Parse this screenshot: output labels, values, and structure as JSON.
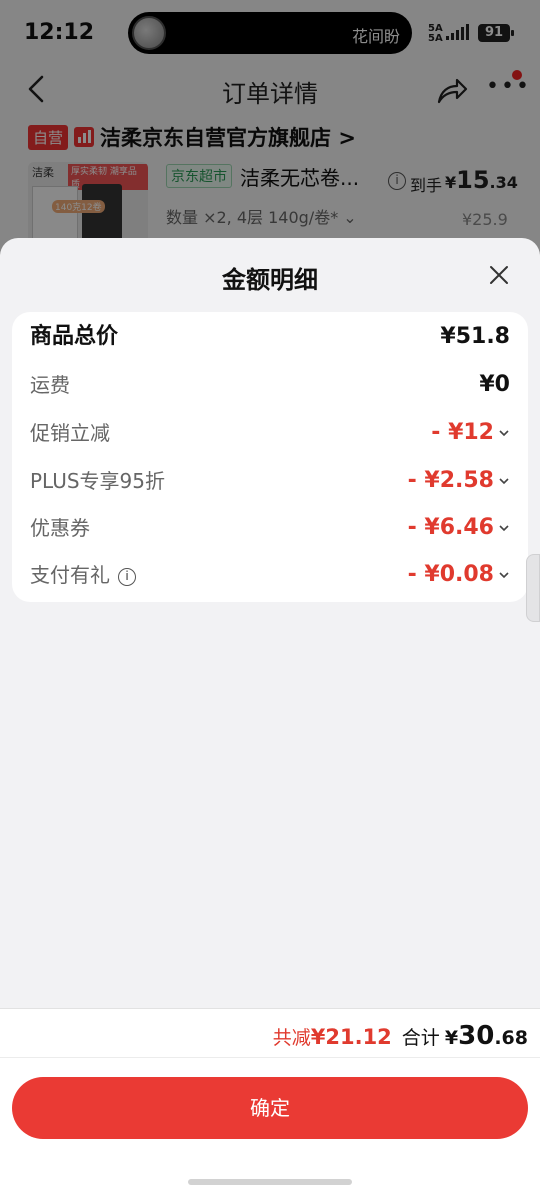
{
  "status_bar": {
    "time": "12:12",
    "island_text": "花间盼",
    "signal_top": "5A",
    "signal_bottom": "5A",
    "battery": "91"
  },
  "nav": {
    "title": "订单详情",
    "back_icon": "chevron-left-icon",
    "share_icon": "share-icon",
    "more_icon": "more-icon"
  },
  "order": {
    "self_badge": "自营",
    "shop_name": "洁柔京东自营官方旗舰店 >",
    "market_tag": "京东超市",
    "product_name": "洁柔无芯卷...",
    "price_label": "到手",
    "price_currency": "¥",
    "price_int": "15",
    "price_dec": ".34",
    "spec": "数量 ×2, 4层 140g/卷* ⌄",
    "original_price": "¥25.9",
    "img_brand": "洁柔",
    "img_tag": "厚实柔韧 潮享品质",
    "img_count": "140克12卷"
  },
  "sheet": {
    "title": "金额明细",
    "close_icon": "close-icon",
    "rows": [
      {
        "label": "商品总价",
        "value": "¥51.8"
      },
      {
        "label": "运费",
        "value": "¥0"
      },
      {
        "label": "促销立减",
        "value": "- ¥12"
      },
      {
        "label": "PLUS专享95折",
        "value": "- ¥2.58"
      },
      {
        "label": "优惠券",
        "value": "- ¥6.46"
      },
      {
        "label": "支付有礼",
        "value": "- ¥0.08"
      }
    ]
  },
  "footer": {
    "save_label": "共减",
    "save_value": "¥21.12",
    "total_label": "合计",
    "total_currency": "¥",
    "total_int": "30",
    "total_dec": ".68",
    "confirm_label": "确定"
  },
  "colors": {
    "accent_red": "#e03a2e",
    "button_red": "#ea3a34",
    "market_green": "#2a9a56"
  }
}
